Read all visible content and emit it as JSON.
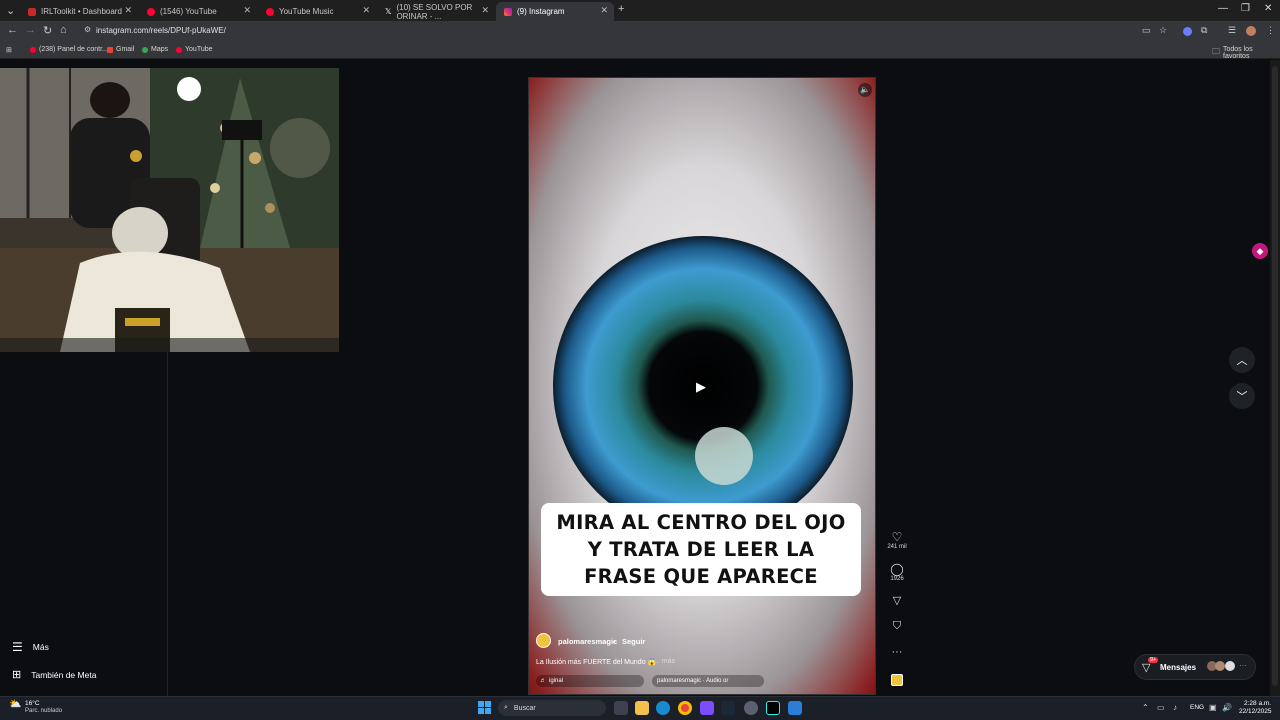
{
  "browser": {
    "tabs": [
      {
        "label": "IRLToolkit • Dashboard",
        "color": "#c62828"
      },
      {
        "label": "(1546) YouTube",
        "color": "#ff0033"
      },
      {
        "label": "YouTube Music",
        "color": "#ff0033"
      },
      {
        "label": "(10) SE SOLVO POR ORINAR - ...",
        "color": "#ffffff"
      },
      {
        "label": "(9) Instagram",
        "color": "#d62976"
      }
    ],
    "new_tab": "+",
    "url": "instagram.com/reels/DPUf-pUkaWE/",
    "bookmarks": [
      {
        "label": "(238) Panel de contr...",
        "color": "#ff0033"
      },
      {
        "label": "Gmail",
        "color": "#ea4335"
      },
      {
        "label": "Maps",
        "color": "#34a853"
      },
      {
        "label": "YouTube",
        "color": "#ff0033"
      }
    ],
    "favorites": "Todos los favoritos"
  },
  "sidebar": {
    "more": "Más",
    "meta": "También de Meta"
  },
  "reel": {
    "caption_overlay": "MIRA AL CENTRO DEL OJO\nY TRATA DE LEER LA\nFRASE QUE APARECE",
    "username": "palomaresmagic",
    "follow": "Seguir",
    "separator": "•",
    "description": "La Ilusión más FUERTE del Mundo 😱",
    "more": "... más",
    "audio_left": "iginal",
    "audio_right": "palomaresmagic · Audio or",
    "likes": "241 mil",
    "comments": "1926"
  },
  "messages": {
    "label": "Mensajes",
    "badge": "9+"
  },
  "taskbar": {
    "temp": "16°C",
    "weather": "Parc. nublado",
    "search": "Buscar",
    "lang": "ENG",
    "time": "2:28 a.m.",
    "date": "22/12/2025"
  }
}
